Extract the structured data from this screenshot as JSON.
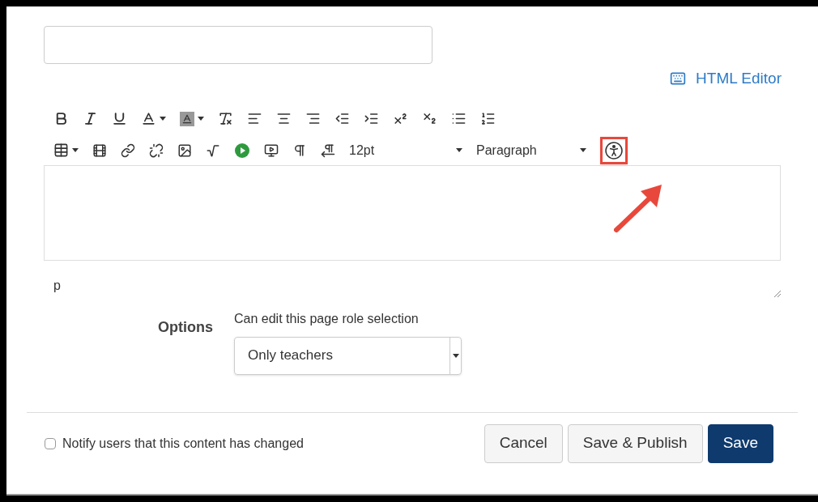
{
  "html_editor_link": "HTML Editor",
  "toolbar": {
    "font_size": "12pt",
    "block_format": "Paragraph",
    "accessibility_highlighted": true
  },
  "editor": {
    "path": "p"
  },
  "options": {
    "label": "Options",
    "field_label": "Can edit this page role selection",
    "value": "Only teachers"
  },
  "notify": {
    "label": "Notify users that this content has changed",
    "checked": false
  },
  "buttons": [
    {
      "label": "Cancel",
      "kind": "default"
    },
    {
      "label": "Save & Publish",
      "kind": "default"
    },
    {
      "label": "Save",
      "kind": "primary"
    }
  ]
}
